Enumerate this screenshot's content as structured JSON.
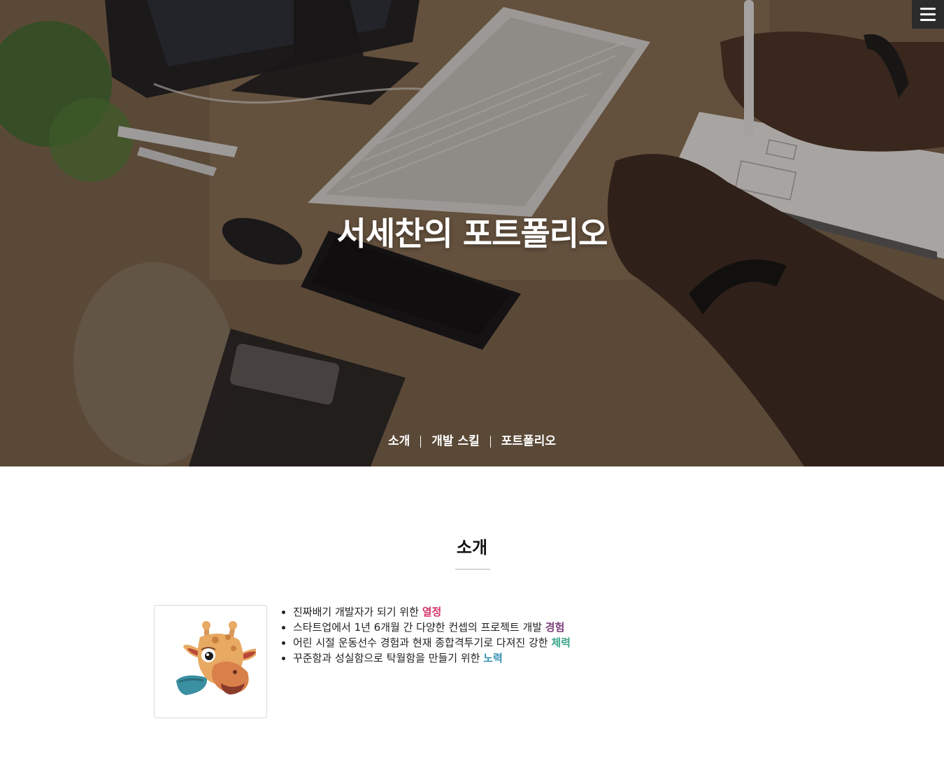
{
  "hero": {
    "title": "서세찬의 포트폴리오",
    "nav": [
      {
        "label": "소개"
      },
      {
        "label": "개발 스킬"
      },
      {
        "label": "포트폴리오"
      }
    ]
  },
  "menu": {
    "icon": "hamburger-menu-icon"
  },
  "intro": {
    "title": "소개",
    "items": [
      {
        "text": "진짜배기 개발자가 되기 위한 ",
        "highlight": "열정",
        "color": "#d6336c"
      },
      {
        "text": "스타트업에서 1년 6개월 간 다양한 컨셉의 프로젝트 개발 ",
        "highlight": "경험",
        "color": "#7b3f7a"
      },
      {
        "text": "어린 시절 운동선수 경험과 현재 종합격투기로 다져진 강한 ",
        "highlight": "체력",
        "color": "#3aa58a"
      },
      {
        "text": "꾸준함과 성실함으로 탁월함을 만들기 위한 ",
        "highlight": "노력",
        "color": "#2f8fb0"
      }
    ]
  }
}
